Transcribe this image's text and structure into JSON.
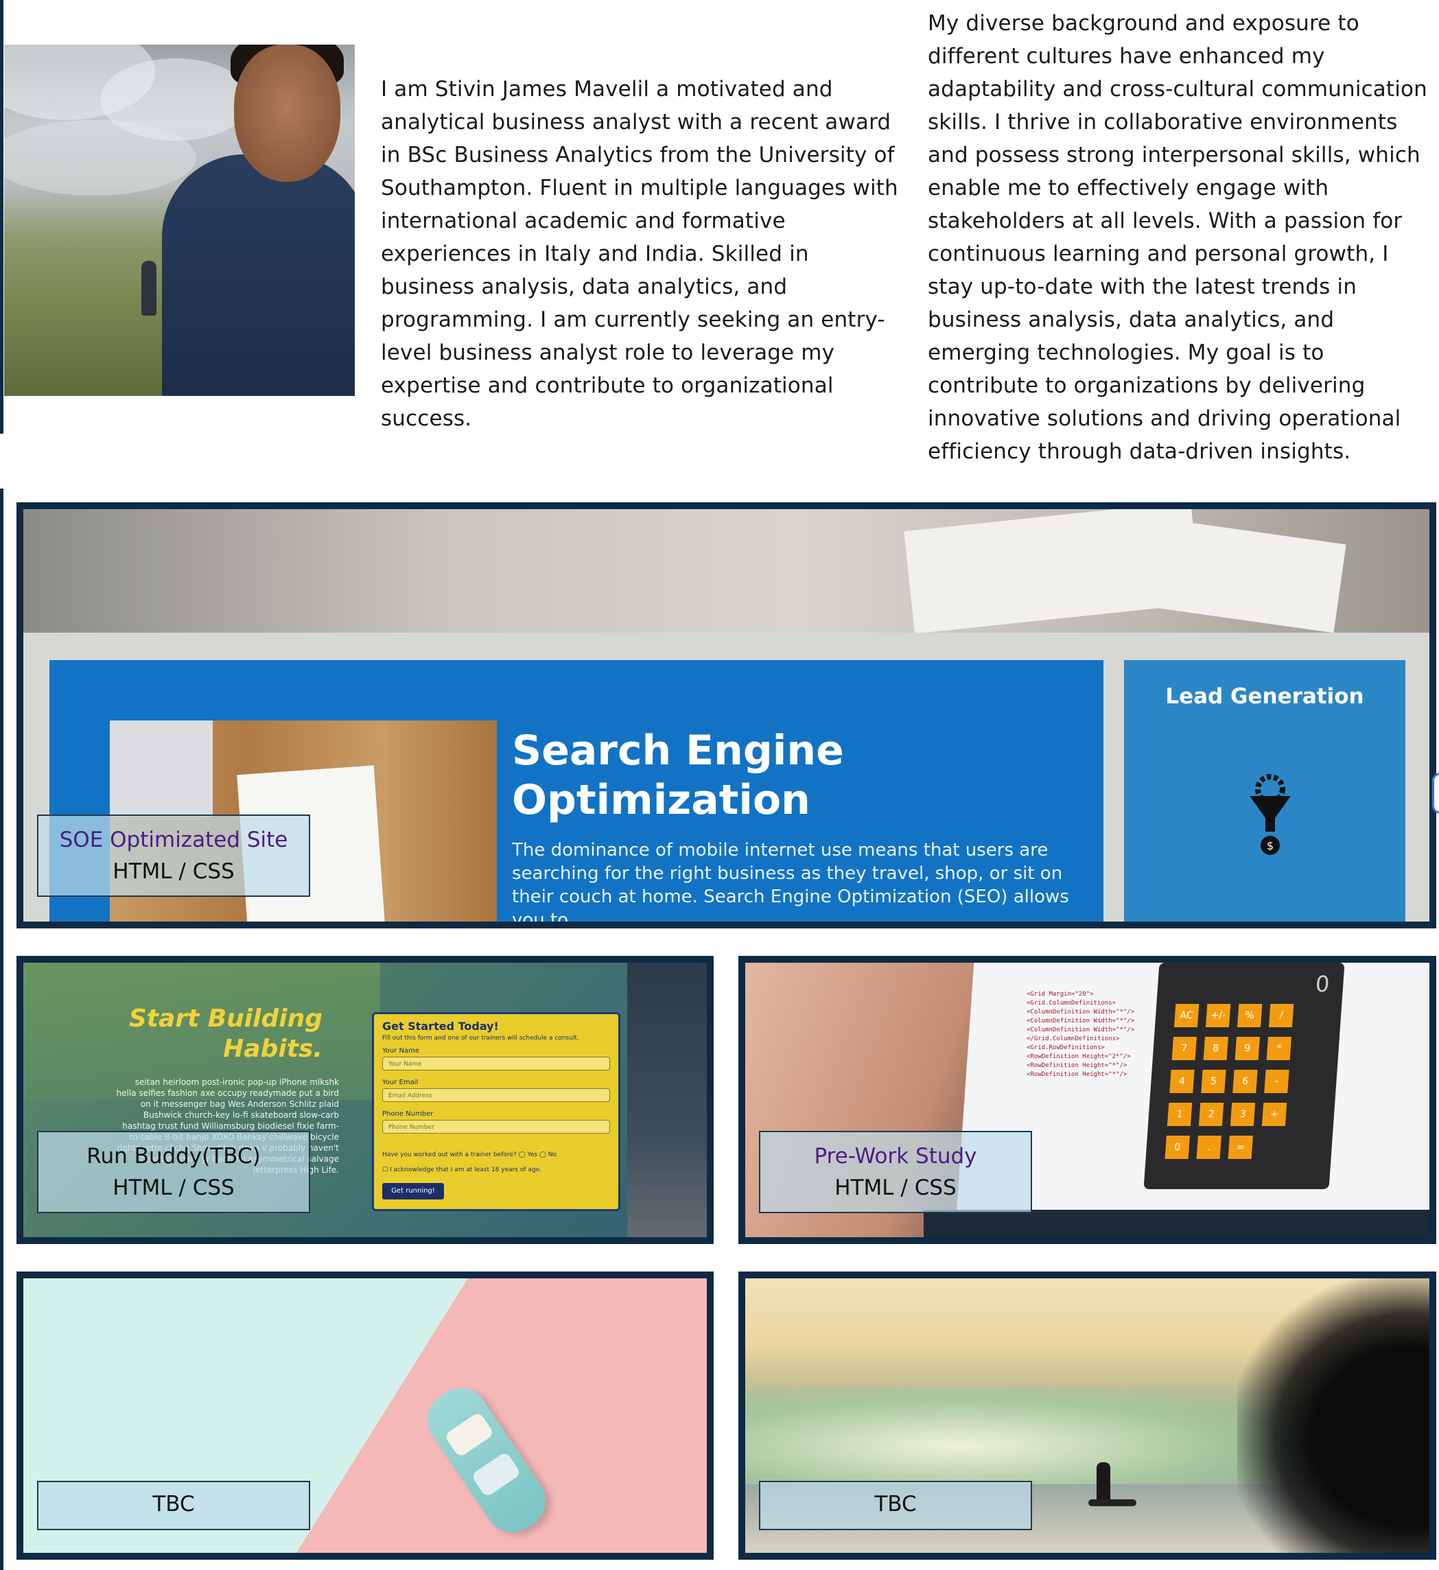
{
  "about": {
    "paragraph_1": "I am Stivin James Mavelil a motivated and analytical business analyst with a recent award in BSc Business Analytics from the University of Southampton. Fluent in multiple languages with international academic and formative experiences in Italy and India. Skilled in business analysis, data analytics, and programming. I am currently seeking an entry-level business analyst role to leverage my expertise and contribute to organizational success.",
    "paragraph_2": "My diverse background and exposure to different cultures have enhanced my adaptability and cross-cultural communication skills. I thrive in collaborative environments and possess strong interpersonal skills, which enable me to effectively engage with stakeholders at all levels. With a passion for continuous learning and personal growth, I stay up-to-date with the latest trends in business analysis, data analytics, and emerging technologies. My goal is to contribute to organizations by delivering innovative solutions and driving operational efficiency through data-driven insights."
  },
  "projects": [
    {
      "title": "SOE Optimizated Site",
      "tech": "HTML / CSS",
      "screenshot": {
        "heading": "Search Engine Optimization",
        "paragraph": "The dominance of mobile internet use means that users are searching for the right business as they travel, shop, or sit on their couch at home. Search Engine Optimization (SEO) allows you to",
        "side_heading": "Lead Generation"
      }
    },
    {
      "title": "Run Buddy(TBC)",
      "tech": "HTML / CSS",
      "screenshot": {
        "heading": "Start Building Habits.",
        "body": "seitan heirloom post-ironic pop-up iPhone mlkshk hella selfies fashion axe occupy readymade put a bird on it messenger bag Wes Anderson Schlitz plaid Bushwick church-key lo-fi skateboard slow-carb hashtag trust fund Williamsburg biodiesel fixie farm-to-table 8-bit banjo XOXO Banksy chillwave bicycle rights retro cliche Shoreditch deep v probably haven't heard of them yr banh mi asymmetrical salvage letterpress High Life.",
        "form_title": "Get Started Today!",
        "form_subtitle": "Fill out this form and one of our trainers will schedule a consult.",
        "name_label": "Your Name",
        "name_placeholder": "Your Name",
        "email_label": "Your Email",
        "email_placeholder": "Email Address",
        "phone_label": "Phone Number",
        "phone_placeholder": "Phone Number",
        "question": "Have you worked out with a trainer before?",
        "yes": "Yes",
        "no": "No",
        "acknowledge": "I acknowledge that I am at least 18 years of age.",
        "button": "Get running!"
      }
    },
    {
      "title": "Pre-Work Study",
      "tech": "HTML / CSS",
      "screenshot": {
        "calc_display": "0",
        "calc_keys": [
          "AC",
          "+/-",
          "%",
          "/",
          "7",
          "8",
          "9",
          "*",
          "4",
          "5",
          "6",
          "-",
          "1",
          "2",
          "3",
          "+",
          "0",
          ".",
          "="
        ]
      }
    },
    {
      "title": "TBC"
    },
    {
      "title": "TBC"
    }
  ],
  "colors": {
    "card_border": "#0f2a44",
    "caption_title": "#4b1d84",
    "caption_bg": "rgba(190,220,232,0.70)"
  }
}
